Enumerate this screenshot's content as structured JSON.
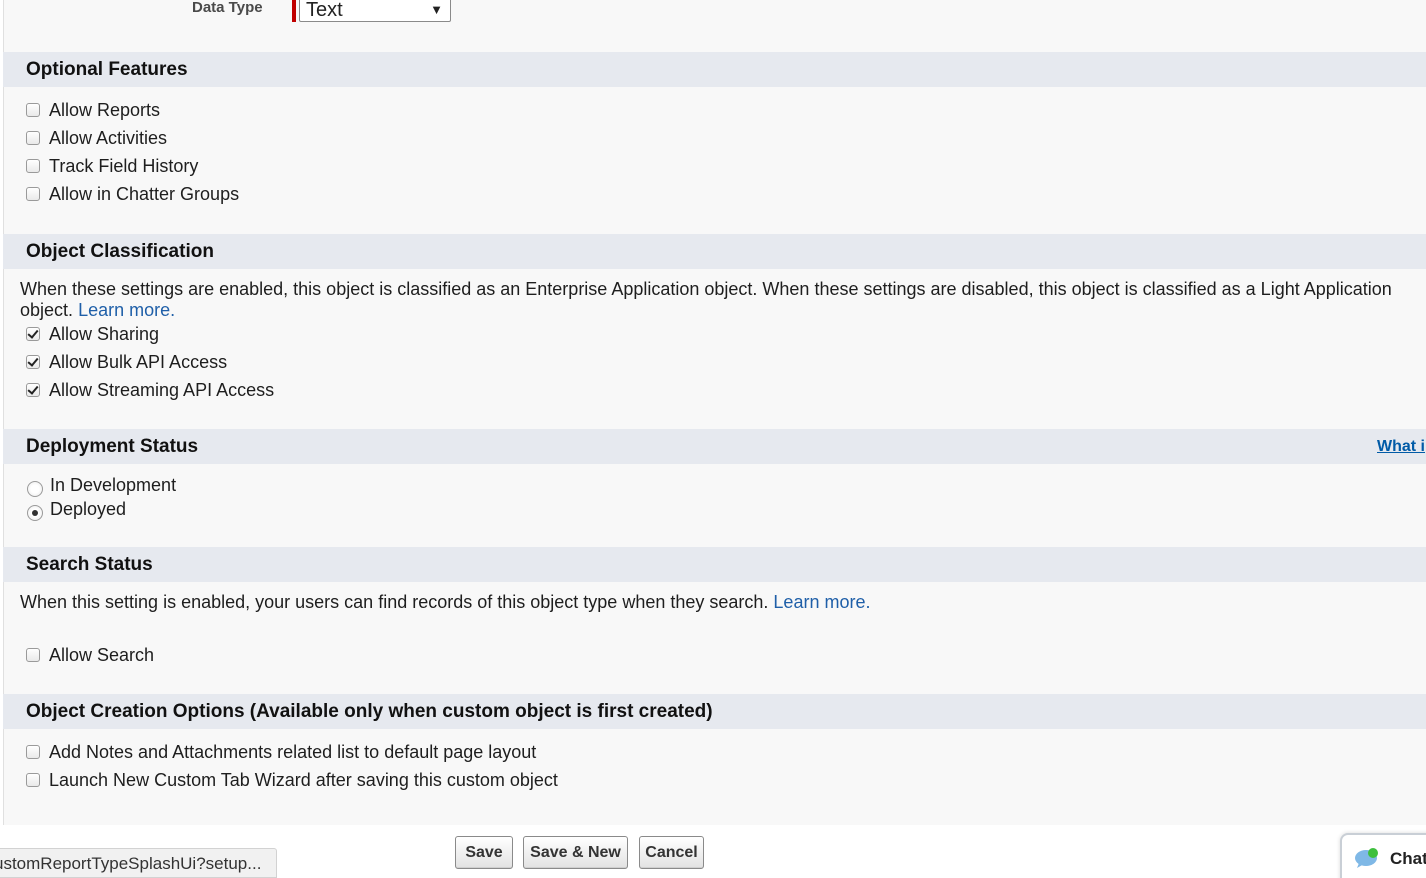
{
  "data_type": {
    "label": "Data Type",
    "selected": "Text"
  },
  "optional_features": {
    "title": "Optional Features",
    "items": [
      {
        "label": "Allow Reports",
        "checked": false
      },
      {
        "label": "Allow Activities",
        "checked": false
      },
      {
        "label": "Track Field History",
        "checked": false
      },
      {
        "label": "Allow in Chatter Groups",
        "checked": false
      }
    ]
  },
  "object_classification": {
    "title": "Object Classification",
    "description": "When these settings are enabled, this object is classified as an Enterprise Application object. When these settings are disabled, this object is classified as a Light Application object.",
    "learn_more": "Learn more.",
    "items": [
      {
        "label": "Allow Sharing",
        "checked": true
      },
      {
        "label": "Allow Bulk API Access",
        "checked": true
      },
      {
        "label": "Allow Streaming API Access",
        "checked": true
      }
    ]
  },
  "deployment_status": {
    "title": "Deployment Status",
    "help_link": "What i",
    "options": [
      {
        "label": "In Development",
        "selected": false
      },
      {
        "label": "Deployed",
        "selected": true
      }
    ]
  },
  "search_status": {
    "title": "Search Status",
    "description": "When this setting is enabled, your users can find records of this object type when they search.",
    "learn_more": "Learn more.",
    "items": [
      {
        "label": "Allow Search",
        "checked": false
      }
    ]
  },
  "object_creation_options": {
    "title": "Object Creation Options (Available only when custom object is first created)",
    "items": [
      {
        "label": "Add Notes and Attachments related list to default page layout",
        "checked": false
      },
      {
        "label": "Launch New Custom Tab Wizard after saving this custom object",
        "checked": false
      }
    ]
  },
  "buttons": {
    "save": "Save",
    "save_new": "Save & New",
    "cancel": "Cancel"
  },
  "status_bar": {
    "url": "ustomReportTypeSplashUi?setup..."
  },
  "chat": {
    "label": "Chat"
  }
}
